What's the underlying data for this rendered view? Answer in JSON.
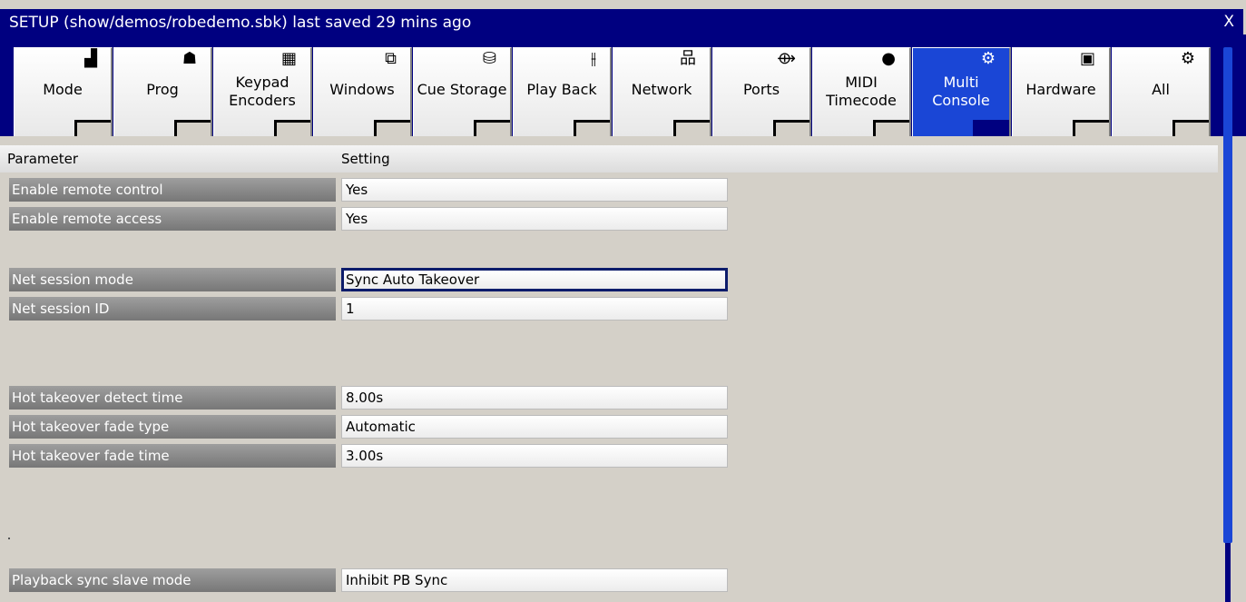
{
  "window": {
    "title": "SETUP (show/demos/robedemo.sbk) last saved 29 mins ago",
    "close_label": "X"
  },
  "tabs": [
    {
      "label": "Mode",
      "icon": "people-podium-icon",
      "glyph": "▟",
      "active": false
    },
    {
      "label": "Prog",
      "icon": "fixture-icon",
      "glyph": "☗",
      "active": false
    },
    {
      "label": "Keypad\nEncoders",
      "icon": "keypad-icon",
      "glyph": "▦",
      "active": false
    },
    {
      "label": "Windows",
      "icon": "windows-icon",
      "glyph": "⧉",
      "active": false
    },
    {
      "label": "Cue Storage",
      "icon": "database-icon",
      "glyph": "⛁",
      "active": false
    },
    {
      "label": "Play Back",
      "icon": "faders-icon",
      "glyph": "⫲",
      "active": false
    },
    {
      "label": "Network",
      "icon": "network-icon",
      "glyph": "品",
      "active": false
    },
    {
      "label": "Ports",
      "icon": "usb-icon",
      "glyph": "⟴",
      "active": false
    },
    {
      "label": "MIDI\nTimecode",
      "icon": "midi-icon",
      "glyph": "●",
      "active": false
    },
    {
      "label": "Multi\nConsole",
      "icon": "gear-icon",
      "glyph": "⚙",
      "active": true
    },
    {
      "label": "Hardware",
      "icon": "chip-icon",
      "glyph": "▣",
      "active": false
    },
    {
      "label": "All",
      "icon": "gear-icon",
      "glyph": "⚙",
      "active": false
    }
  ],
  "table": {
    "col_parameter": "Parameter",
    "col_setting": "Setting",
    "rows": [
      {
        "label": "Enable remote control",
        "value": "Yes"
      },
      {
        "label": "Enable remote access",
        "value": "Yes"
      },
      {
        "label": "Net session mode",
        "value": "Sync Auto Takeover",
        "focused": true
      },
      {
        "label": "Net session ID",
        "value": "1"
      },
      {
        "label": "Hot takeover detect time",
        "value": "8.00s"
      },
      {
        "label": "Hot takeover fade type",
        "value": "Automatic"
      },
      {
        "label": "Hot takeover fade time",
        "value": "3.00s"
      },
      {
        "label": "Playback sync slave mode",
        "value": "Inhibit PB Sync"
      }
    ]
  },
  "colors": {
    "titlebar": "#000080",
    "active_tab": "#1a46d6",
    "panel": "#d4d0c8"
  }
}
